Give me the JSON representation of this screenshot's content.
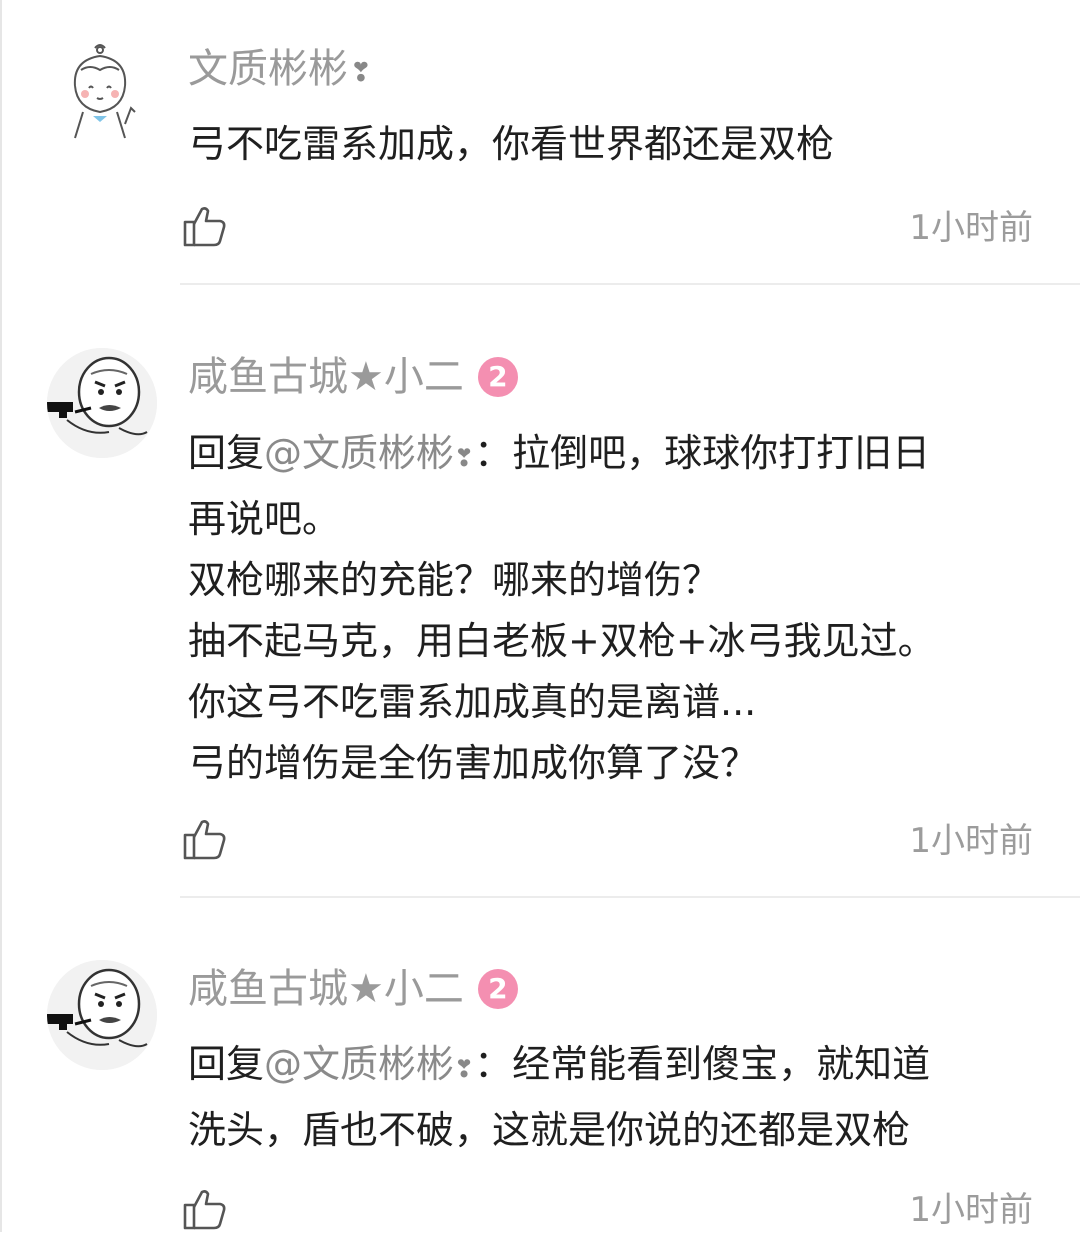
{
  "comments": [
    {
      "username": "文质彬彬",
      "username_heart": "❣",
      "level": "",
      "avatar_icon": "cartoon-girl-avatar",
      "reply_prefix": "",
      "mention": "",
      "body_lines": [
        "弓不吃雷系加成，你看世界都还是双枪"
      ],
      "time": "1小时前"
    },
    {
      "username": "咸鱼古城★小二",
      "username_heart": "",
      "level": "2",
      "avatar_icon": "meme-face-avatar",
      "reply_prefix": "回复",
      "mention": "@文质彬彬",
      "mention_heart": "❣",
      "first_line_rest": "：拉倒吧，球球你打打旧日",
      "body_lines": [
        "再说吧。",
        "双枪哪来的充能？哪来的增伤？",
        "抽不起马克，用白老板+双枪+冰弓我见过。",
        "你这弓不吃雷系加成真的是离谱...",
        "弓的增伤是全伤害加成你算了没？"
      ],
      "time": "1小时前"
    },
    {
      "username": "咸鱼古城★小二",
      "username_heart": "",
      "level": "2",
      "avatar_icon": "meme-face-avatar",
      "reply_prefix": "回复",
      "mention": "@文质彬彬",
      "mention_heart": "❣",
      "first_line_rest": "：经常能看到傻宝，就知道",
      "body_lines": [
        "洗头，盾也不破，这就是你说的还都是双枪"
      ],
      "time": "1小时前"
    }
  ],
  "icons": {
    "like": "thumbs-up-icon"
  },
  "colors": {
    "username": "#9a9a9a",
    "mention": "#8a8a8a",
    "level_badge": "#f48fb1",
    "time": "#9c9c9c",
    "divider": "#ececec"
  }
}
